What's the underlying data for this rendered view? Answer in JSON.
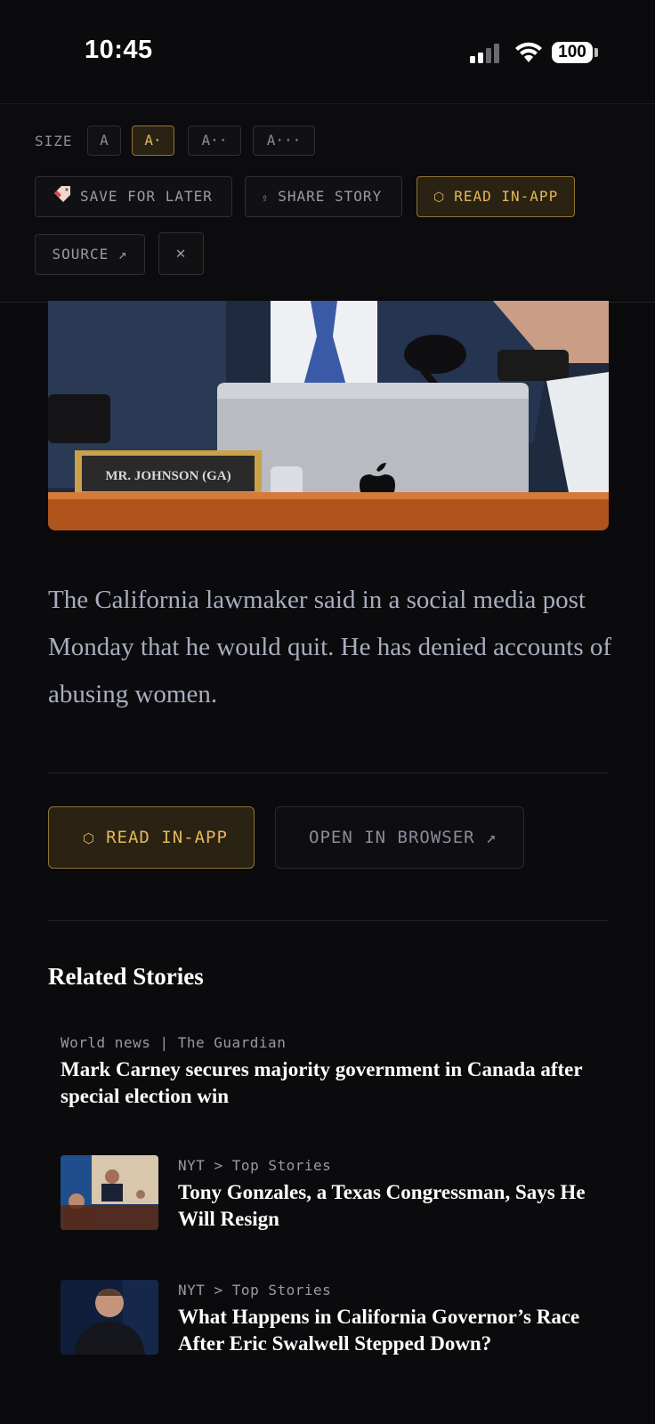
{
  "status": {
    "time": "10:45",
    "battery": "100"
  },
  "toolbar": {
    "size_label": "SIZE",
    "sizes": [
      "A",
      "A·",
      "A··",
      "A···"
    ],
    "active_size": "A·",
    "save_label": "SAVE FOR LATER",
    "share_label": "SHARE STORY",
    "read_label": "READ IN-APP",
    "source_label": "SOURCE ↗",
    "close_label": "✕"
  },
  "hero": {
    "nameplate": "MR. JOHNSON (GA)"
  },
  "article": {
    "dek": "The California lawmaker said in a social media post Monday that he would quit. He has denied accounts of abusing women."
  },
  "actions": {
    "read_in_app": "READ IN-APP",
    "open_browser": "OPEN IN BROWSER ↗"
  },
  "related": {
    "title": "Related Stories",
    "items": [
      {
        "meta": "World news | The Guardian",
        "headline": "Mark Carney secures majority government in Canada after special election win"
      },
      {
        "meta": "NYT > Top Stories",
        "headline": "Tony Gonzales, a Texas Congressman, Says He Will Resign"
      },
      {
        "meta": "NYT > Top Stories",
        "headline": "What Happens in California Governor’s Race After Eric Swalwell Stepped Down?"
      }
    ]
  },
  "colors": {
    "background": "#0b0b0d",
    "accent_gold": "#e2b85a",
    "gold_border": "#8f7434",
    "muted_text": "#9a9aa0",
    "dek_text": "#a9adbf"
  },
  "icons": {
    "save": "bookmark-tag-icon",
    "share": "share-icon",
    "read": "hexagon-icon",
    "close": "close-icon"
  }
}
